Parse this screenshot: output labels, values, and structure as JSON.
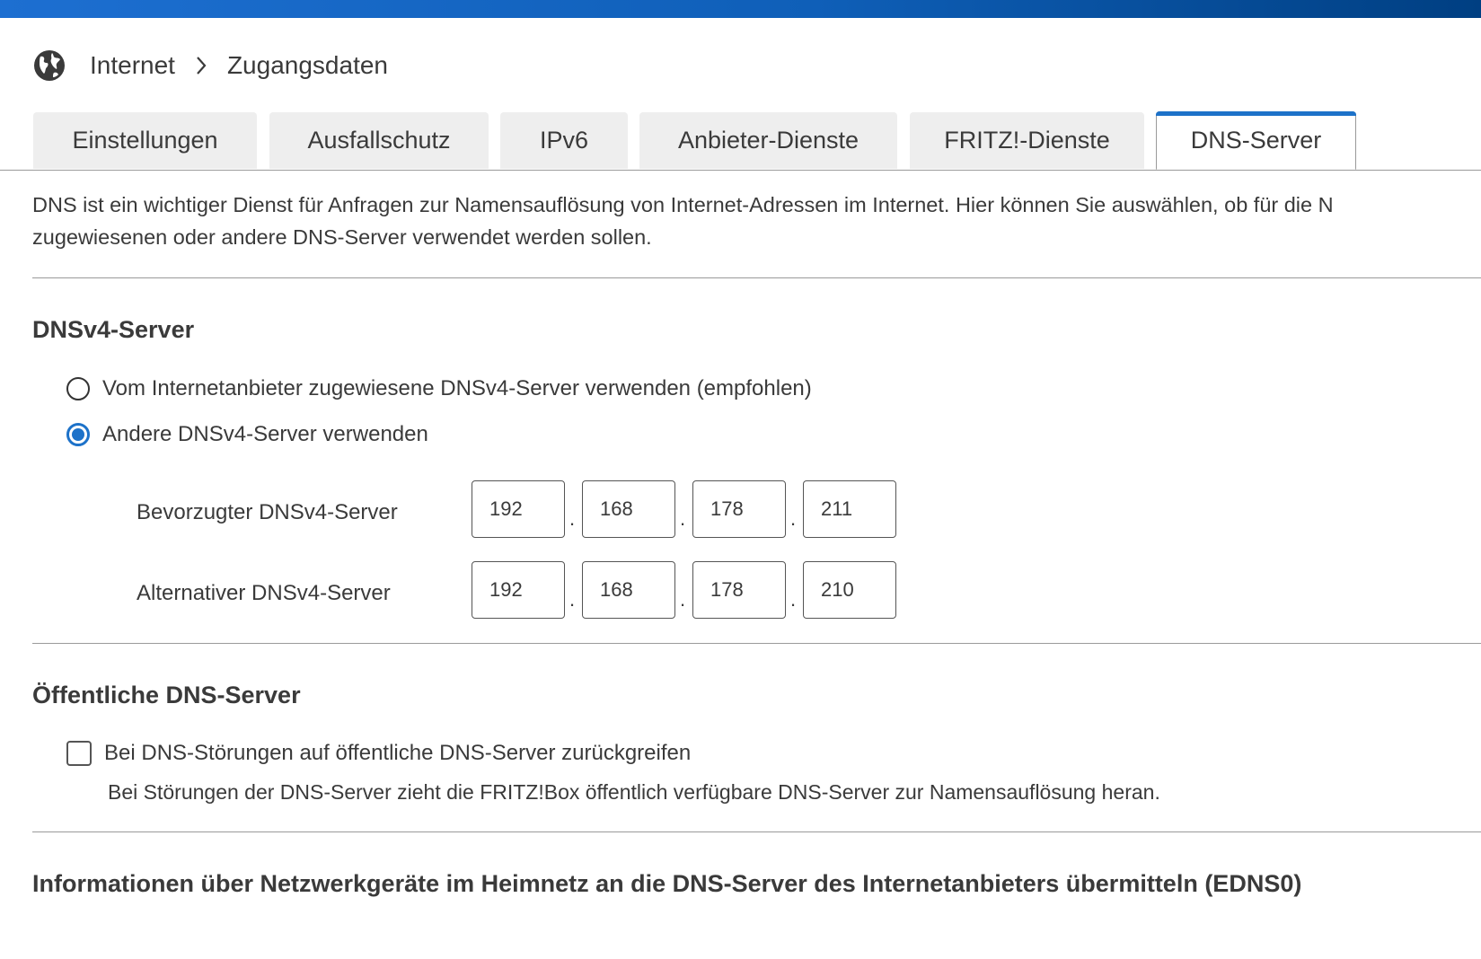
{
  "header": {
    "breadcrumb": [
      "Internet",
      "Zugangsdaten"
    ]
  },
  "tabs": [
    {
      "label": "Einstellungen",
      "active": false
    },
    {
      "label": "Ausfallschutz",
      "active": false
    },
    {
      "label": "IPv6",
      "active": false
    },
    {
      "label": "Anbieter-Dienste",
      "active": false
    },
    {
      "label": "FRITZ!-Dienste",
      "active": false
    },
    {
      "label": "DNS-Server",
      "active": true
    }
  ],
  "intro": {
    "line1": "DNS ist ein wichtiger Dienst für Anfragen zur Namensauflösung von Internet-Adressen im Internet. Hier können Sie auswählen, ob für die N",
    "line2": "zugewiesenen oder andere DNS-Server verwendet werden sollen."
  },
  "dnsv4": {
    "title": "DNSv4-Server",
    "options": [
      {
        "label": "Vom Internetanbieter zugewiesene DNSv4-Server verwenden (empfohlen)",
        "checked": false
      },
      {
        "label": "Andere DNSv4-Server verwenden",
        "checked": true
      }
    ],
    "preferred": {
      "label": "Bevorzugter DNSv4-Server",
      "octets": [
        "192",
        "168",
        "178",
        "211"
      ]
    },
    "alternative": {
      "label": "Alternativer DNSv4-Server",
      "octets": [
        "192",
        "168",
        "178",
        "210"
      ]
    },
    "separator": "."
  },
  "public_dns": {
    "title": "Öffentliche DNS-Server",
    "checkbox_label": "Bei DNS-Störungen auf öffentliche DNS-Server zurückgreifen",
    "checked": false,
    "hint": "Bei Störungen der DNS-Server zieht die FRITZ!Box öffentlich verfügbare DNS-Server zur Namensauflösung heran."
  },
  "edns0": {
    "title": "Informationen über Netzwerkgeräte im Heimnetz an die DNS-Server des Internetanbieters übermitteln (EDNS0)"
  },
  "colors": {
    "accent": "#1d72c9",
    "topbar_start": "#1d6fd1",
    "topbar_end": "#003f82",
    "text": "#3a3a3a",
    "tab_inactive_bg": "#eeeeee",
    "rule": "#9a9a9a"
  },
  "icons": {
    "breadcrumb_root": "globe-icon",
    "breadcrumb_separator": "chevron-right-icon"
  }
}
